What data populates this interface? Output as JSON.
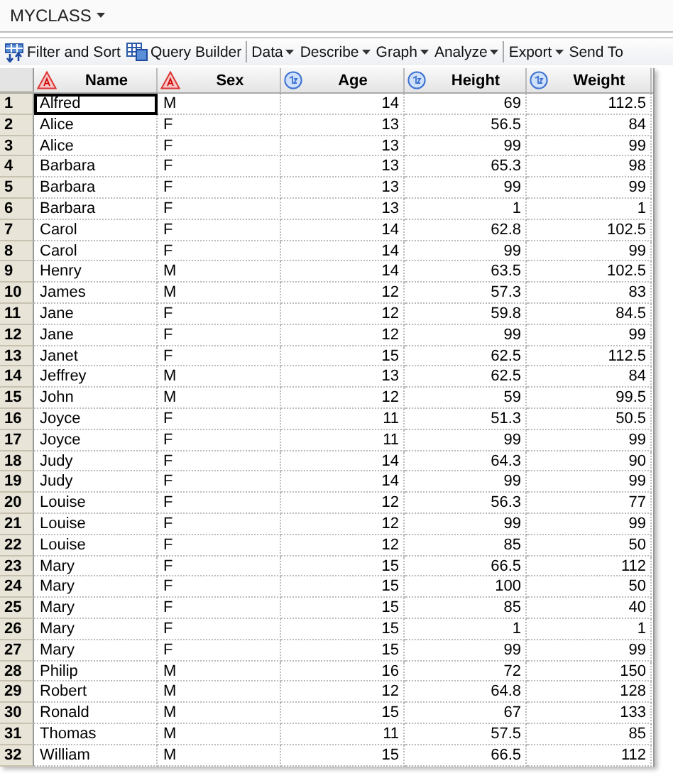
{
  "tab": {
    "title": "MYCLASS",
    "dropdown": true
  },
  "toolbar": [
    {
      "label": "Filter and Sort",
      "kind": "filter",
      "dropdown": false
    },
    {
      "label": "Query Builder",
      "kind": "query",
      "dropdown": false
    },
    {
      "kind": "separator"
    },
    {
      "label": "Data",
      "kind": "menu",
      "dropdown": true
    },
    {
      "label": "Describe",
      "kind": "menu",
      "dropdown": true
    },
    {
      "label": "Graph",
      "kind": "menu",
      "dropdown": true
    },
    {
      "label": "Analyze",
      "kind": "menu",
      "dropdown": true
    },
    {
      "kind": "separator"
    },
    {
      "label": "Export",
      "kind": "menu",
      "dropdown": true
    },
    {
      "label": "Send To",
      "kind": "menu",
      "dropdown": false
    }
  ],
  "table": {
    "columns": [
      {
        "label": "Name",
        "kind": "character"
      },
      {
        "label": "Sex",
        "kind": "character"
      },
      {
        "label": "Age",
        "kind": "numeric"
      },
      {
        "label": "Height",
        "kind": "numeric"
      },
      {
        "label": "Weight",
        "kind": "numeric"
      }
    ],
    "rows": [
      {
        "number": "1",
        "cells": [
          "Alfred",
          "M",
          "14",
          "69",
          "112.5"
        ],
        "selected": true
      },
      {
        "number": "2",
        "cells": [
          "Alice",
          "F",
          "13",
          "56.5",
          "84"
        ],
        "selected": false
      },
      {
        "number": "3",
        "cells": [
          "Alice",
          "F",
          "13",
          "99",
          "99"
        ],
        "selected": false
      },
      {
        "number": "4",
        "cells": [
          "Barbara",
          "F",
          "13",
          "65.3",
          "98"
        ],
        "selected": false
      },
      {
        "number": "5",
        "cells": [
          "Barbara",
          "F",
          "13",
          "99",
          "99"
        ],
        "selected": false
      },
      {
        "number": "6",
        "cells": [
          "Barbara",
          "F",
          "13",
          "1",
          "1"
        ],
        "selected": false
      },
      {
        "number": "7",
        "cells": [
          "Carol",
          "F",
          "14",
          "62.8",
          "102.5"
        ],
        "selected": false
      },
      {
        "number": "8",
        "cells": [
          "Carol",
          "F",
          "14",
          "99",
          "99"
        ],
        "selected": false
      },
      {
        "number": "9",
        "cells": [
          "Henry",
          "M",
          "14",
          "63.5",
          "102.5"
        ],
        "selected": false
      },
      {
        "number": "10",
        "cells": [
          "James",
          "M",
          "12",
          "57.3",
          "83"
        ],
        "selected": false
      },
      {
        "number": "11",
        "cells": [
          "Jane",
          "F",
          "12",
          "59.8",
          "84.5"
        ],
        "selected": false
      },
      {
        "number": "12",
        "cells": [
          "Jane",
          "F",
          "12",
          "99",
          "99"
        ],
        "selected": false
      },
      {
        "number": "13",
        "cells": [
          "Janet",
          "F",
          "15",
          "62.5",
          "112.5"
        ],
        "selected": false
      },
      {
        "number": "14",
        "cells": [
          "Jeffrey",
          "M",
          "13",
          "62.5",
          "84"
        ],
        "selected": false
      },
      {
        "number": "15",
        "cells": [
          "John",
          "M",
          "12",
          "59",
          "99.5"
        ],
        "selected": false
      },
      {
        "number": "16",
        "cells": [
          "Joyce",
          "F",
          "11",
          "51.3",
          "50.5"
        ],
        "selected": false
      },
      {
        "number": "17",
        "cells": [
          "Joyce",
          "F",
          "11",
          "99",
          "99"
        ],
        "selected": false
      },
      {
        "number": "18",
        "cells": [
          "Judy",
          "F",
          "14",
          "64.3",
          "90"
        ],
        "selected": false
      },
      {
        "number": "19",
        "cells": [
          "Judy",
          "F",
          "14",
          "99",
          "99"
        ],
        "selected": false
      },
      {
        "number": "20",
        "cells": [
          "Louise",
          "F",
          "12",
          "56.3",
          "77"
        ],
        "selected": false
      },
      {
        "number": "21",
        "cells": [
          "Louise",
          "F",
          "12",
          "99",
          "99"
        ],
        "selected": false
      },
      {
        "number": "22",
        "cells": [
          "Louise",
          "F",
          "12",
          "85",
          "50"
        ],
        "selected": false
      },
      {
        "number": "23",
        "cells": [
          "Mary",
          "F",
          "15",
          "66.5",
          "112"
        ],
        "selected": false
      },
      {
        "number": "24",
        "cells": [
          "Mary",
          "F",
          "15",
          "100",
          "50"
        ],
        "selected": false
      },
      {
        "number": "25",
        "cells": [
          "Mary",
          "F",
          "15",
          "85",
          "40"
        ],
        "selected": false
      },
      {
        "number": "26",
        "cells": [
          "Mary",
          "F",
          "15",
          "1",
          "1"
        ],
        "selected": false
      },
      {
        "number": "27",
        "cells": [
          "Mary",
          "F",
          "15",
          "99",
          "99"
        ],
        "selected": false
      },
      {
        "number": "28",
        "cells": [
          "Philip",
          "M",
          "16",
          "72",
          "150"
        ],
        "selected": false
      },
      {
        "number": "29",
        "cells": [
          "Robert",
          "M",
          "12",
          "64.8",
          "128"
        ],
        "selected": false
      },
      {
        "number": "30",
        "cells": [
          "Ronald",
          "M",
          "15",
          "67",
          "133"
        ],
        "selected": false
      },
      {
        "number": "31",
        "cells": [
          "Thomas",
          "M",
          "11",
          "57.5",
          "85"
        ],
        "selected": false
      },
      {
        "number": "32",
        "cells": [
          "William",
          "M",
          "15",
          "66.5",
          "112"
        ],
        "selected": false
      }
    ]
  }
}
